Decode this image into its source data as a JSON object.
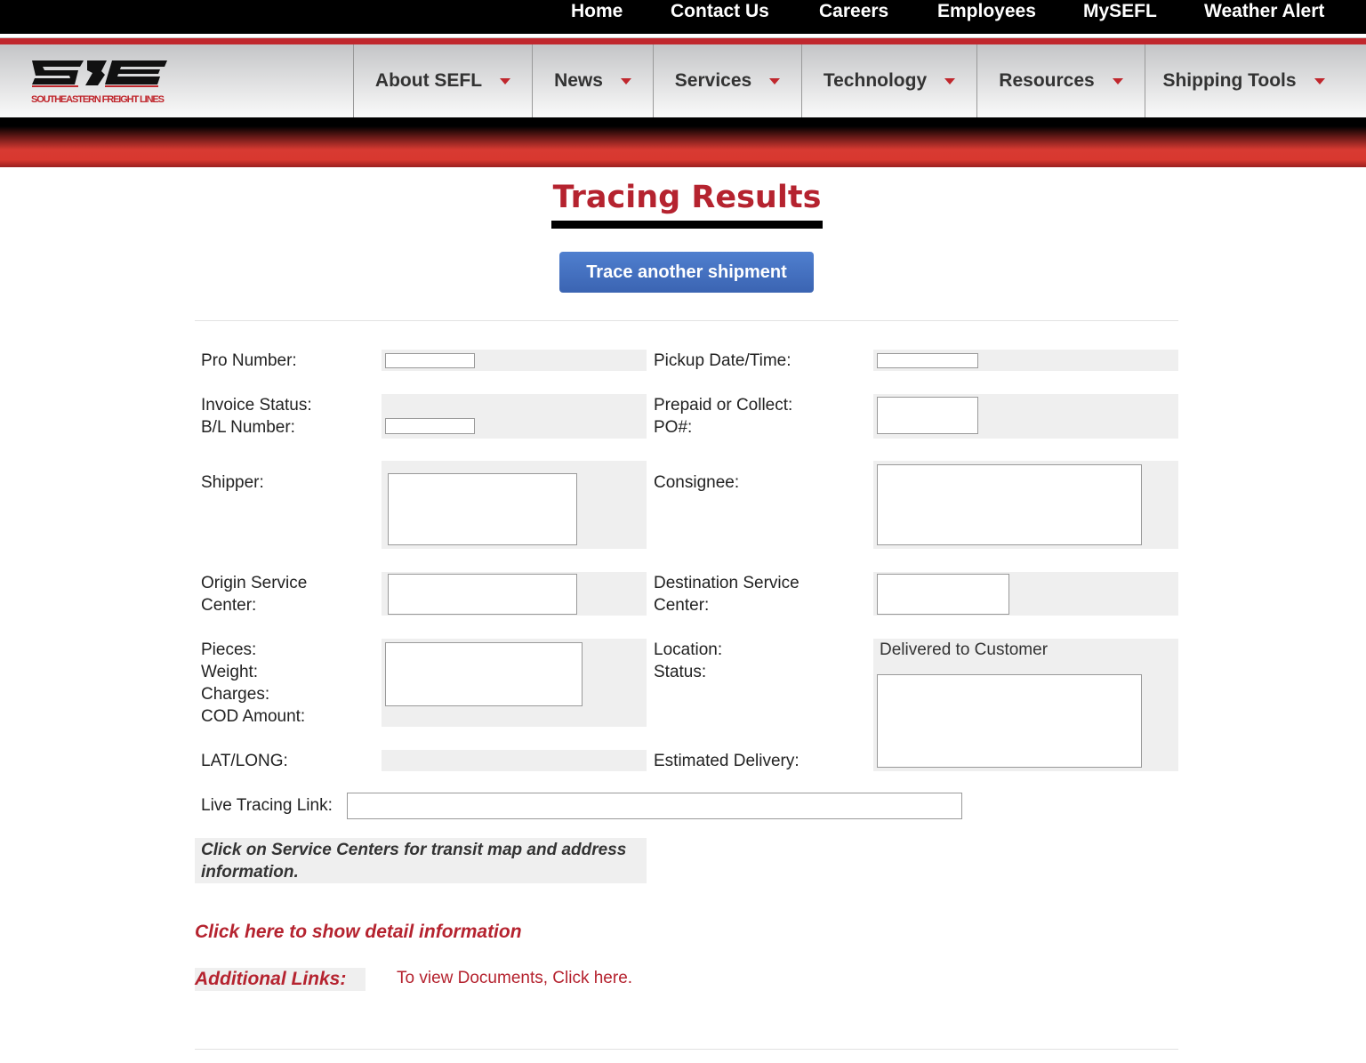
{
  "topnav": [
    "Home",
    "Contact Us",
    "Careers",
    "Employees",
    "MySEFL",
    "Weather Alert"
  ],
  "logo": {
    "text": "SOUTHEASTERN FREIGHT LINES",
    "brand_color": "#c0272d"
  },
  "mainnav": [
    "About SEFL",
    "News",
    "Services",
    "Technology",
    "Resources",
    "Shipping Tools"
  ],
  "page_title": "Tracing Results",
  "trace_button": "Trace another shipment",
  "fields": {
    "pro_number": "Pro Number:",
    "pickup": "Pickup Date/Time:",
    "invoice_status": "Invoice Status:",
    "bl_number": "B/L Number:",
    "prepaid": "Prepaid or Collect:",
    "po": "PO#:",
    "shipper": "Shipper:",
    "consignee": "Consignee:",
    "origin1": "Origin Service",
    "origin2": "Center:",
    "dest1": "Destination Service",
    "dest2": "Center:",
    "pieces": "Pieces:",
    "weight": "Weight:",
    "charges": "Charges:",
    "cod": "COD Amount:",
    "location": "Location:",
    "status": "Status:",
    "status_value": "Delivered to Customer",
    "latlong": "LAT/LONG:",
    "est_delivery": "Estimated Delivery:",
    "live_link": "Live Tracing Link:"
  },
  "note": "Click on Service Centers for transit map and address information.",
  "detail_link": "Click here to show detail information",
  "additional_label": "Additional Links:",
  "documents_link": "To view Documents, Click here.",
  "colors": {
    "accent_red": "#b5232f",
    "button_blue": "#3f6bbd"
  }
}
